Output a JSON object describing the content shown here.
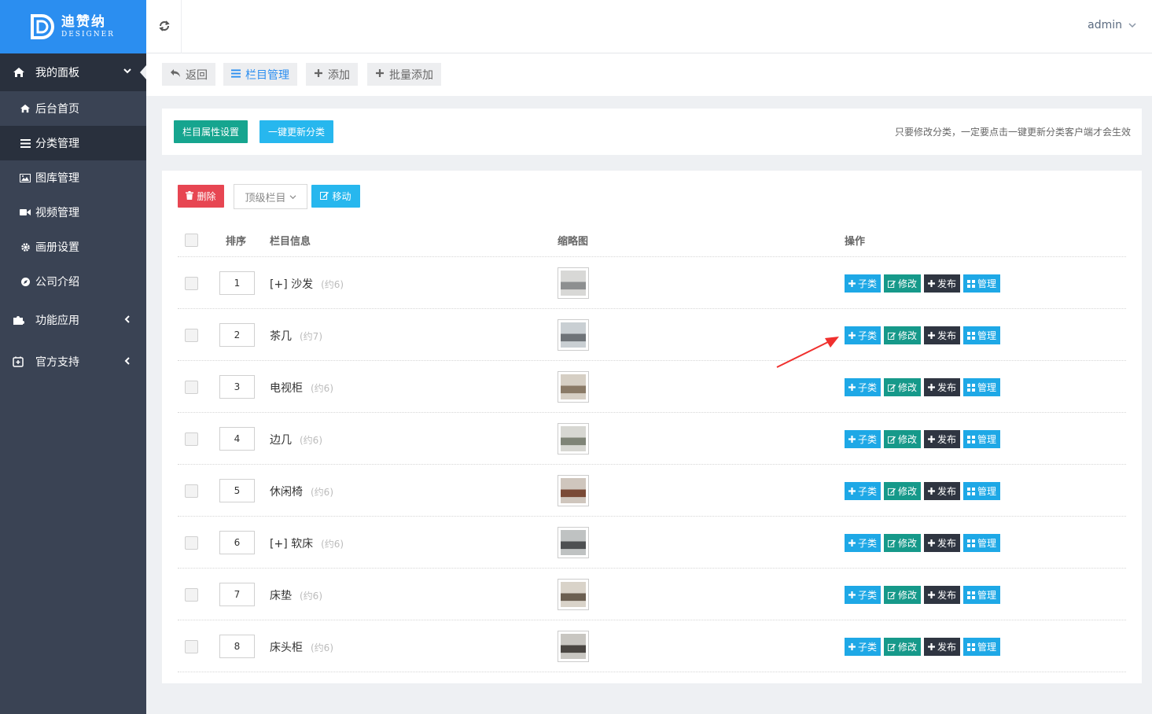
{
  "brand": {
    "cn": "迪赞纳",
    "en": "DESIGNER"
  },
  "header": {
    "user": "admin"
  },
  "sidebar": {
    "dashboard": "我的面板",
    "items": [
      {
        "label": "后台首页",
        "icon": "home-icon"
      },
      {
        "label": "分类管理",
        "icon": "list-icon",
        "active": true
      },
      {
        "label": "图库管理",
        "icon": "image-icon"
      },
      {
        "label": "视频管理",
        "icon": "video-icon"
      },
      {
        "label": "画册设置",
        "icon": "gear-icon"
      },
      {
        "label": "公司介绍",
        "icon": "compass-icon"
      }
    ],
    "groups": [
      {
        "label": "功能应用",
        "icon": "puzzle-icon"
      },
      {
        "label": "官方支持",
        "icon": "plus-square-icon"
      }
    ]
  },
  "tabs": [
    {
      "label": "返回",
      "icon": "reply-icon"
    },
    {
      "label": "栏目管理",
      "icon": "list-icon",
      "active": true
    },
    {
      "label": "添加",
      "icon": "plus-icon"
    },
    {
      "label": "批量添加",
      "icon": "plus-icon"
    }
  ],
  "toolbar": {
    "attr_btn": "栏目属性设置",
    "refresh_btn": "一键更新分类",
    "hint": "只要修改分类，一定要点击一键更新分类客户端才会生效"
  },
  "actions": {
    "delete": "删除",
    "select_value": "顶级栏目",
    "move": "移动"
  },
  "table": {
    "headers": {
      "sort": "排序",
      "info": "栏目信息",
      "thumb": "缩略图",
      "ops": "操作"
    },
    "op_labels": {
      "sub": "子类",
      "edit": "修改",
      "pub": "发布",
      "mgr": "管理"
    },
    "rows": [
      {
        "sort": "1",
        "name": "[+] 沙发",
        "count": "(约6)"
      },
      {
        "sort": "2",
        "name": "茶几",
        "count": "(约7)"
      },
      {
        "sort": "3",
        "name": "电视柜",
        "count": "(约6)"
      },
      {
        "sort": "4",
        "name": "边几",
        "count": "(约6)"
      },
      {
        "sort": "5",
        "name": "休闲椅",
        "count": "(约6)"
      },
      {
        "sort": "6",
        "name": "[+] 软床",
        "count": "(约6)"
      },
      {
        "sort": "7",
        "name": "床垫",
        "count": "(约6)"
      },
      {
        "sort": "8",
        "name": "床头柜",
        "count": "(约6)"
      }
    ]
  },
  "colors": {
    "brand_blue": "#2b8ef0",
    "sidebar": "#3a4354",
    "green": "#16a58f",
    "cyan": "#27b7ee",
    "red": "#e74652",
    "arrow": "#f0302e"
  }
}
